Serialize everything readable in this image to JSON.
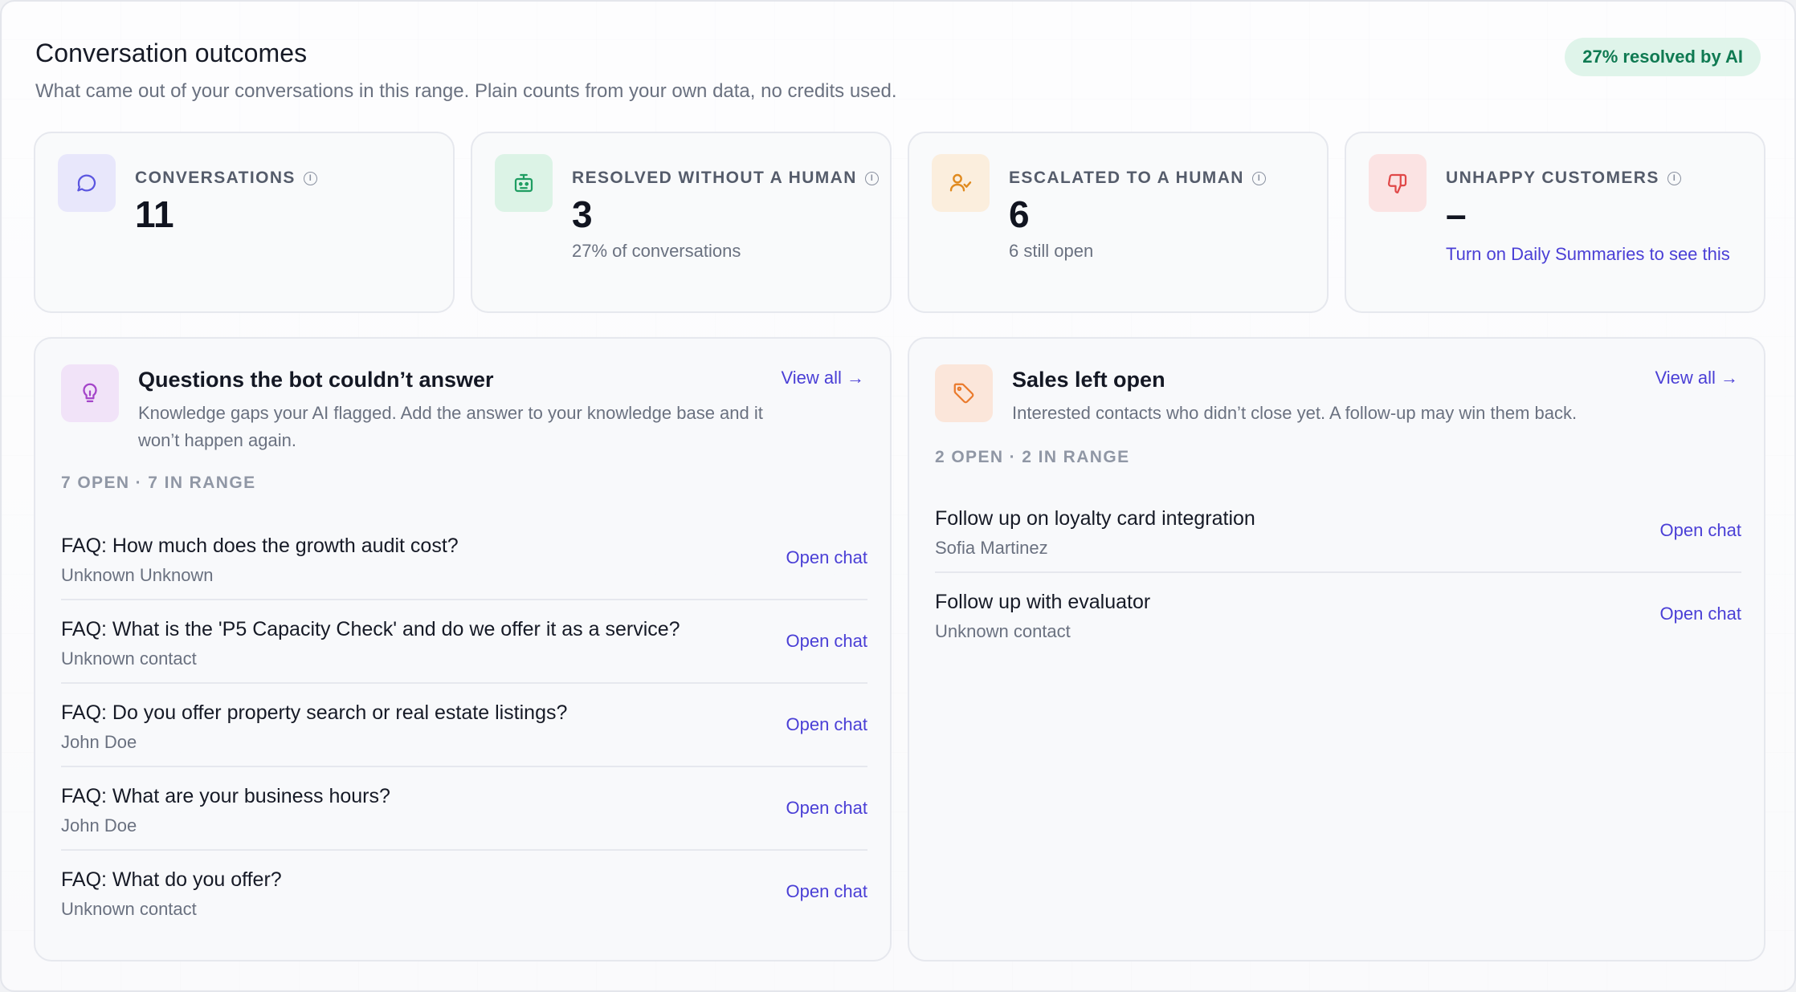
{
  "header": {
    "title": "Conversation outcomes",
    "subtitle": "What came out of your conversations in this range. Plain counts from your own data, no credits used.",
    "badge": "27% resolved by AI"
  },
  "stats": [
    {
      "label": "CONVERSATIONS",
      "value": "11",
      "note": "",
      "icon": "chat-bubble-icon",
      "color": "#5b56e0"
    },
    {
      "label": "RESOLVED WITHOUT A HUMAN",
      "value": "3",
      "note": "27% of conversations",
      "icon": "bot-icon",
      "color": "#1f9d62"
    },
    {
      "label": "ESCALATED TO A HUMAN",
      "value": "6",
      "note": "6 still open",
      "icon": "user-check-icon",
      "color": "#e08a1e"
    },
    {
      "label": "UNHAPPY CUSTOMERS",
      "value": "–",
      "note": "Turn on Daily Summaries to see this",
      "icon": "thumbs-down-icon",
      "color": "#e04848"
    }
  ],
  "knowledge_gaps": {
    "title": "Questions the bot couldn’t answer",
    "description": "Knowledge gaps your AI flagged. Add the answer to your knowledge base and it won’t happen again.",
    "view_all": "View all →",
    "counts": "7 OPEN · 7 IN RANGE",
    "icon": "lightbulb-icon",
    "items": [
      {
        "title": "FAQ: How much does the growth audit cost?",
        "contact": "Unknown Unknown",
        "action": "Open chat"
      },
      {
        "title": "FAQ: What is the 'P5 Capacity Check' and do we offer it as a service?",
        "contact": "Unknown contact",
        "action": "Open chat"
      },
      {
        "title": "FAQ: Do you offer property search or real estate listings?",
        "contact": "John Doe",
        "action": "Open chat"
      },
      {
        "title": "FAQ: What are your business hours?",
        "contact": "John Doe",
        "action": "Open chat"
      },
      {
        "title": "FAQ: What do you offer?",
        "contact": "Unknown contact",
        "action": "Open chat"
      }
    ]
  },
  "sales_open": {
    "title": "Sales left open",
    "description": "Interested contacts who didn’t close yet. A follow-up may win them back.",
    "view_all": "View all →",
    "counts": "2 OPEN · 2 IN RANGE",
    "icon": "tag-icon",
    "items": [
      {
        "title": "Follow up on loyalty card integration",
        "contact": "Sofia Martinez",
        "action": "Open chat"
      },
      {
        "title": "Follow up with evaluator",
        "contact": "Unknown contact",
        "action": "Open chat"
      }
    ]
  }
}
